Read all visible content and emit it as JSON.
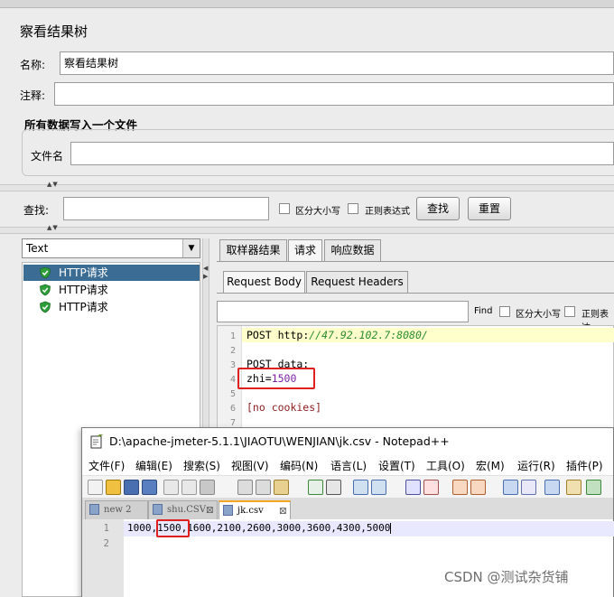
{
  "panel": {
    "title": "察看结果树",
    "name_label": "名称:",
    "name_value": "察看结果树",
    "comment_label": "注释:",
    "comment_value": "",
    "file_group_title": "所有数据写入一个文件",
    "filename_label": "文件名",
    "filename_value": ""
  },
  "search": {
    "label": "查找:",
    "value": "",
    "case_label": "区分大小写",
    "regex_label": "正则表达式",
    "find_button": "查找",
    "reset_button": "重置"
  },
  "renderer": {
    "selected": "Text"
  },
  "tree": {
    "items": [
      "HTTP请求",
      "HTTP请求",
      "HTTP请求"
    ]
  },
  "result_tabs": [
    "取样器结果",
    "请求",
    "响应数据"
  ],
  "request_tabs": [
    "Request Body",
    "Request Headers"
  ],
  "request_find": {
    "find_label": "Find",
    "case_label": "区分大小写",
    "regex_label": "正则表达"
  },
  "request_body": {
    "line_numbers": [
      "1",
      "2",
      "3",
      "4",
      "5",
      "6",
      "7"
    ],
    "line1_method": "POST ",
    "line1_scheme": "http:",
    "line1_url": "//47.92.102.7:8080/",
    "line3": "POST data:",
    "line4_key": "zhi=",
    "line4_value": "1500",
    "line6": "[no cookies]"
  },
  "notepad": {
    "title": "D:\\apache-jmeter-5.1.1\\JIAOTU\\WENJIAN\\jk.csv - Notepad++",
    "menu": [
      "文件(F)",
      "编辑(E)",
      "搜索(S)",
      "视图(V)",
      "编码(N)",
      "语言(L)",
      "设置(T)",
      "工具(O)",
      "宏(M)",
      "运行(R)",
      "插件(P)"
    ],
    "tabs": [
      "new 2",
      "shu.CSV",
      "jk.csv"
    ],
    "line_numbers": [
      "1",
      "2"
    ],
    "line1_a": "1000,",
    "line1_b": "1500",
    "line1_c": ",1600,2100,2600,3000,3600,4300,5000"
  },
  "watermark": "CSDN @测试杂货铺",
  "colors": {
    "tree_selected": "#3b6d94",
    "shield_green": "#2e9e3a",
    "highlight_line": "#ffffcc",
    "number_purple": "#7a1fa2",
    "url_green": "#2a8a2a",
    "red_box": "#e02020",
    "npp_tab_accent": "#f5a623"
  }
}
